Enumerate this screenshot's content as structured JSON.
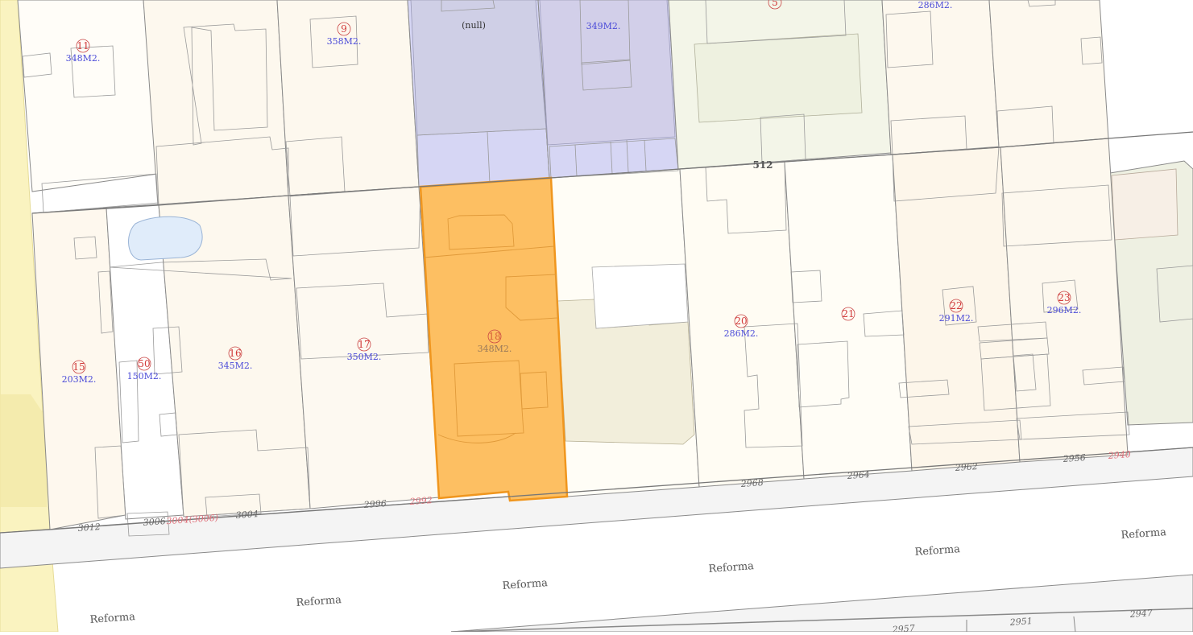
{
  "street_name": "Reforma",
  "block_number": "512",
  "selected_lot": {
    "number": "18",
    "area": "348M2.",
    "address": "2992"
  },
  "lots": [
    {
      "number": "11",
      "area": "348M2."
    },
    {
      "number": "9",
      "area": "358M2."
    },
    {
      "number": "",
      "area": "(null)"
    },
    {
      "number": "",
      "area": "349M2."
    },
    {
      "number": "5",
      "area": ""
    },
    {
      "number": "",
      "area": "286M2."
    },
    {
      "number": "15",
      "area": "203M2."
    },
    {
      "number": "50",
      "area": "150M2."
    },
    {
      "number": "16",
      "area": "345M2."
    },
    {
      "number": "17",
      "area": "350M2."
    },
    {
      "number": "20",
      "area": "286M2."
    },
    {
      "number": "21",
      "area": ""
    },
    {
      "number": "22",
      "area": "291M2."
    },
    {
      "number": "23",
      "area": "296M2."
    }
  ],
  "addresses": [
    "3012",
    "3006",
    "3004(3006)",
    "3004",
    "2996",
    "2992",
    "2968",
    "2964",
    "2962",
    "2956",
    "2940"
  ],
  "south_addresses": [
    "2957",
    "2951",
    "2947"
  ],
  "colors": {
    "selected_fill": "#fdbf62",
    "selected_stroke": "#f0961e",
    "lot_line": "#8a8a8a",
    "purple_lot": "#d6d6f4",
    "yellow_zone": "#faf3c0",
    "green_lot": "#f2f4e8",
    "street_band": "#f4f4f4"
  }
}
